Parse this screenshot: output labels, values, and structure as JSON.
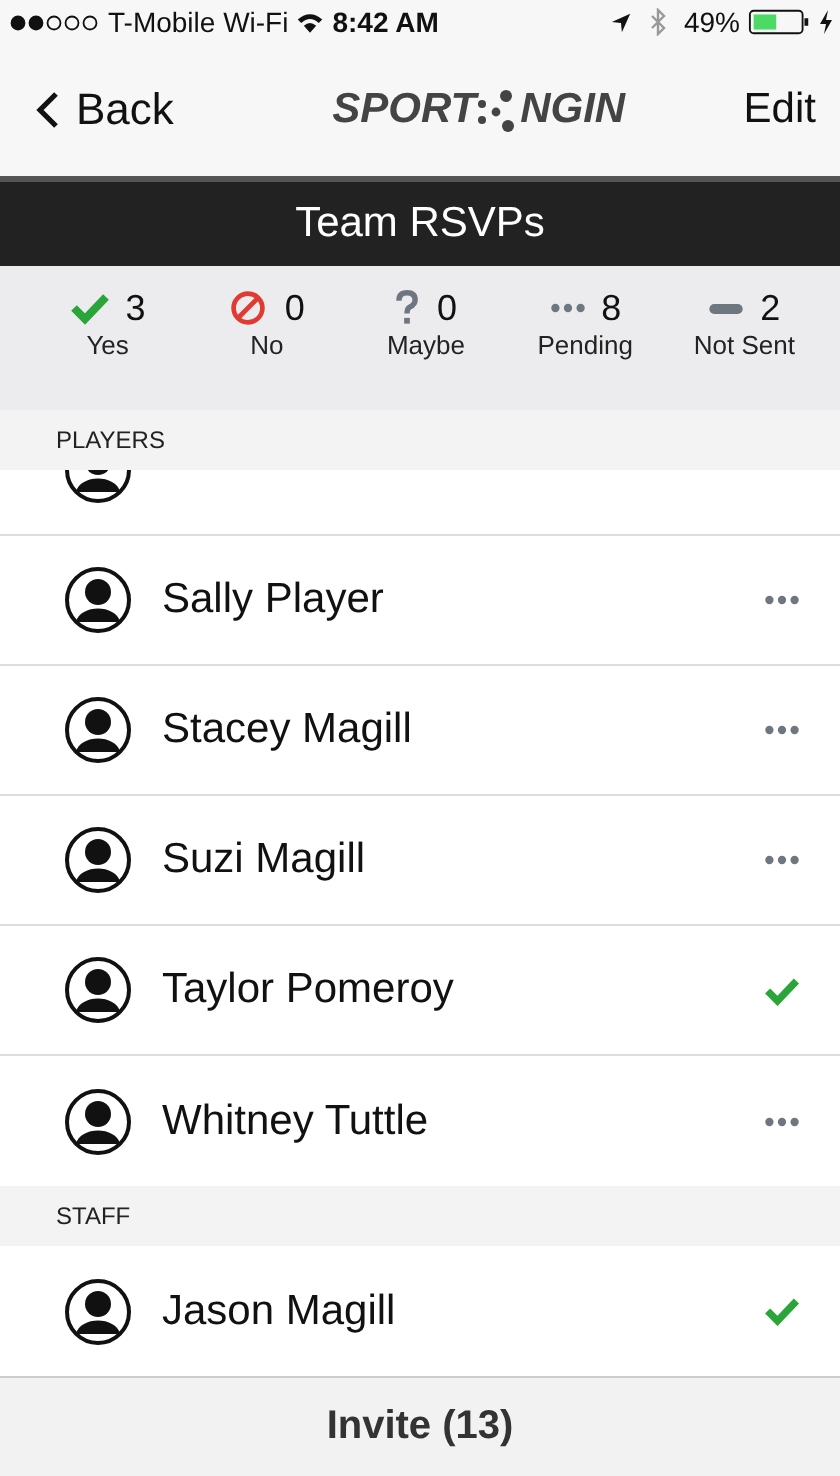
{
  "status_bar": {
    "carrier": "T-Mobile Wi-Fi",
    "time": "8:42 AM",
    "battery": "49%"
  },
  "nav": {
    "back": "Back",
    "logo_left": "SPORT",
    "logo_right": "NGIN",
    "edit": "Edit"
  },
  "title": "Team RSVPs",
  "summary": [
    {
      "kind": "yes",
      "count": "3",
      "label": "Yes"
    },
    {
      "kind": "no",
      "count": "0",
      "label": "No"
    },
    {
      "kind": "maybe",
      "count": "0",
      "label": "Maybe"
    },
    {
      "kind": "pending",
      "count": "8",
      "label": "Pending"
    },
    {
      "kind": "not_sent",
      "count": "2",
      "label": "Not Sent"
    }
  ],
  "sections": [
    {
      "header": "PLAYERS",
      "partial_top": true,
      "rows": [
        {
          "name": "Sally Player",
          "kind": "pending"
        },
        {
          "name": "Stacey Magill",
          "kind": "pending"
        },
        {
          "name": "Suzi Magill",
          "kind": "pending"
        },
        {
          "name": "Taylor Pomeroy",
          "kind": "yes"
        },
        {
          "name": "Whitney Tuttle",
          "kind": "pending"
        }
      ]
    },
    {
      "header": "STAFF",
      "partial_top": false,
      "rows": [
        {
          "name": "Jason Magill",
          "kind": "yes"
        }
      ]
    }
  ],
  "invite": "Invite (13)"
}
